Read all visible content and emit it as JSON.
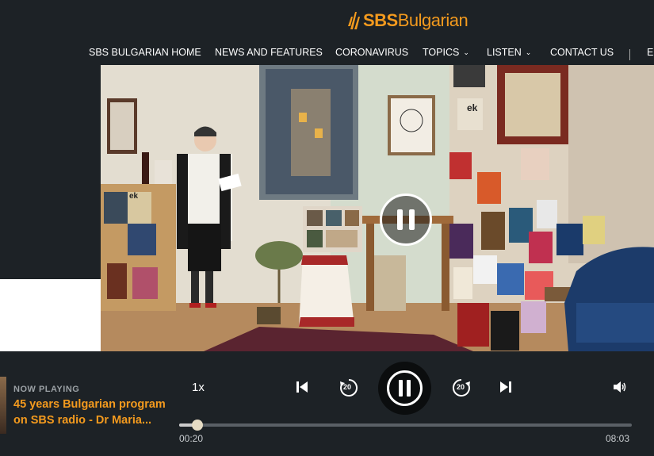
{
  "header": {
    "logo_brand": "SBS",
    "logo_name": "Bulgarian"
  },
  "nav": {
    "items": [
      {
        "label": "SBS BULGARIAN HOME"
      },
      {
        "label": "NEWS AND FEATURES"
      },
      {
        "label": "CORONAVIRUS"
      },
      {
        "label": "TOPICS"
      },
      {
        "label": "LISTEN"
      },
      {
        "label": "CONTACT US"
      },
      {
        "label": "EX"
      }
    ]
  },
  "video": {
    "book_labels": [
      "ek",
      "ek"
    ]
  },
  "player": {
    "now_playing_label": "NOW PLAYING",
    "title_line1": "45 years Bulgarian program",
    "title_line2": "on SBS radio - Dr Maria...",
    "speed": "1x",
    "rewind_seconds": "20",
    "forward_seconds": "20",
    "progress": 0.04,
    "elapsed": "00:20",
    "duration": "08:03"
  },
  "colors": {
    "accent": "#f39a1e",
    "background": "#1d2226"
  }
}
